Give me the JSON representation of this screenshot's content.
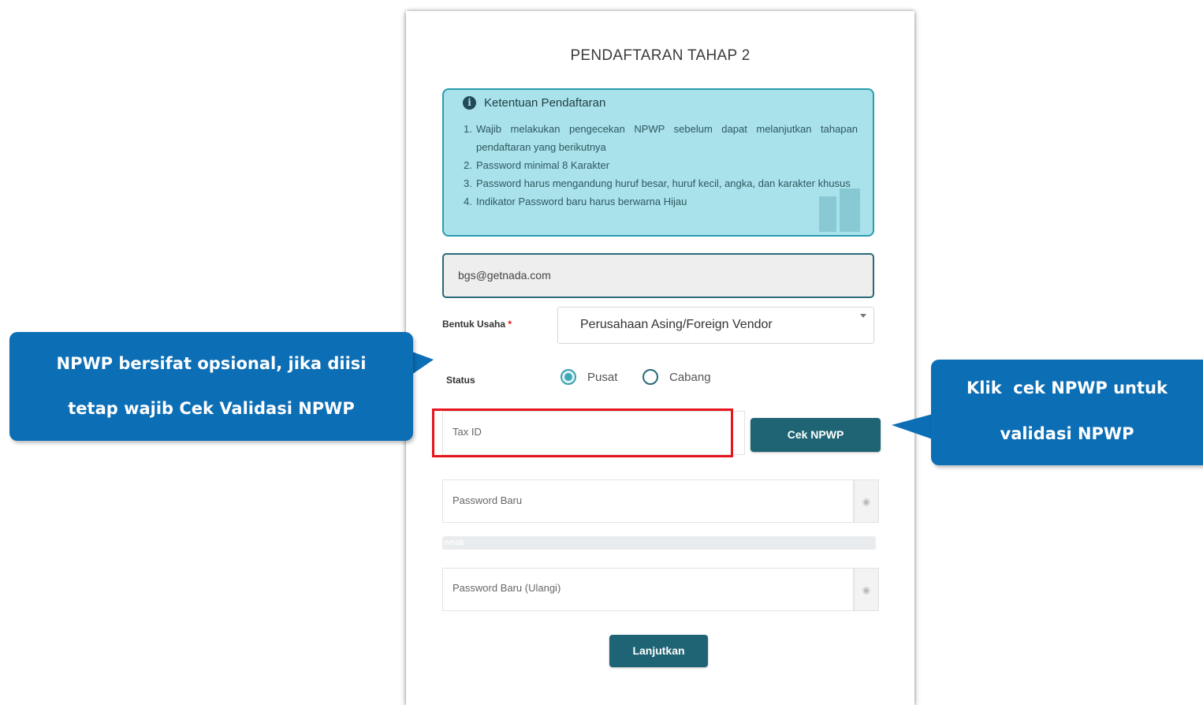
{
  "form": {
    "title": "PENDAFTARAN TAHAP 2",
    "info": {
      "heading": "Ketentuan Pendaftaran",
      "items": [
        {
          "num": "1.",
          "text": "Wajib melakukan pengecekan NPWP sebelum dapat melanjutkan tahapan pendaftaran yang berikutnya"
        },
        {
          "num": "2.",
          "text": "Password minimal 8 Karakter"
        },
        {
          "num": "3.",
          "text": "Password harus mengandung huruf besar, huruf kecil, angka, dan karakter khusus"
        },
        {
          "num": "4.",
          "text": "Indikator Password baru harus berwarna Hijau"
        }
      ]
    },
    "email_value": "bgs@getnada.com",
    "bentuk_usaha": {
      "label": "Bentuk Usaha",
      "required_mark": "*",
      "selected": "Perusahaan Asing/Foreign Vendor"
    },
    "status": {
      "label": "Status",
      "options": [
        "Pusat",
        "Cabang"
      ],
      "selected": "Pusat"
    },
    "tax_id_placeholder": "Tax ID",
    "cek_npwp_label": "Cek NPWP",
    "password_placeholder": "Password Baru",
    "strength_text": "weak",
    "password_repeat_placeholder": "Password Baru (Ulangi)",
    "submit_label": "Lanjutkan"
  },
  "callouts": {
    "left": [
      "NPWP bersifat opsional, jika diisi",
      "tetap wajib Cek Validasi NPWP"
    ],
    "right": [
      "Klik  cek NPWP untuk",
      "validasi NPWP"
    ]
  },
  "colors": {
    "accent": "#1e6474",
    "info_bg": "#a9e2ea",
    "callout": "#0c6eb5",
    "highlight": "#e8141c"
  }
}
